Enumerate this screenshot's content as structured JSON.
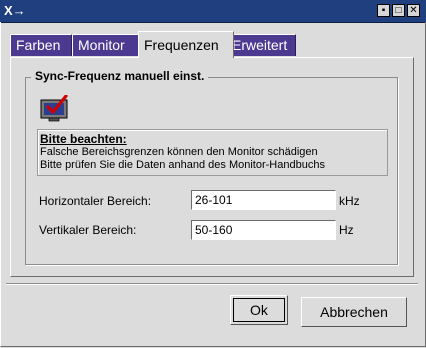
{
  "titlebar": {
    "app_icon": "X→",
    "buttons": [
      {
        "icon": "minimize-icon",
        "glyph": "▪"
      },
      {
        "icon": "maximize-icon",
        "glyph": "□"
      },
      {
        "icon": "close-icon",
        "glyph": "✕"
      }
    ]
  },
  "tabs": [
    {
      "label": "Farben",
      "active": false
    },
    {
      "label": "Monitor",
      "active": false
    },
    {
      "label": "Frequenzen",
      "active": true
    },
    {
      "label": "Erweitert",
      "active": false
    }
  ],
  "group": {
    "title": "Sync-Frequenz manuell einst.",
    "icon": "monitor-check-icon"
  },
  "notice": {
    "heading": "Bitte beachten:",
    "line1": "Falsche Bereichsgrenzen können den Monitor schädigen",
    "line2": "Bitte prüfen Sie die Daten anhand des Monitor-Handbuchs"
  },
  "fields": {
    "horizontal": {
      "label": "Horizontaler Bereich:",
      "value": "26-101",
      "unit": "kHz"
    },
    "vertical": {
      "label": "Vertikaler Bereich:",
      "value": "50-160",
      "unit": "Hz"
    }
  },
  "buttons": {
    "ok": "Ok",
    "cancel": "Abbrechen"
  },
  "colors": {
    "titlebar": "#1f3f7f",
    "tab_inactive": "#4b3a8f",
    "background": "#dcdcdc"
  }
}
